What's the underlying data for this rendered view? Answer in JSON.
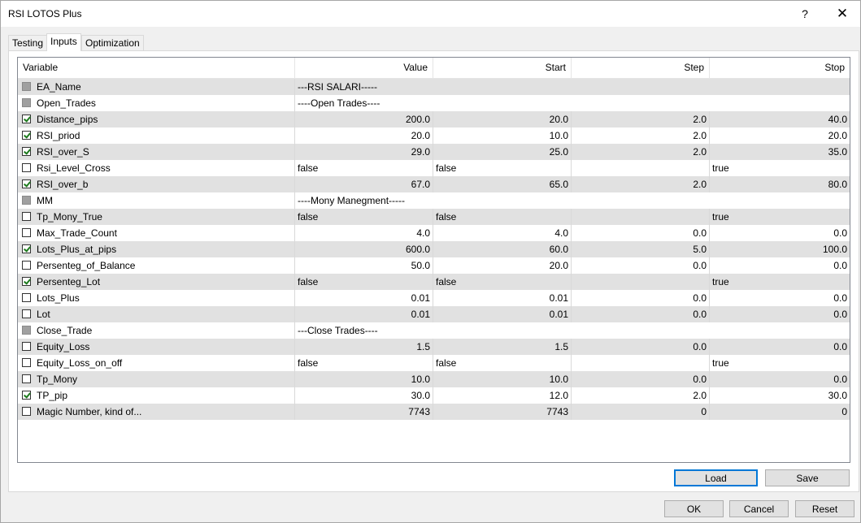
{
  "window": {
    "title": "RSI LOTOS Plus",
    "help_label": "?",
    "close_label": "✕"
  },
  "tabs": [
    {
      "label": "Testing",
      "active": false
    },
    {
      "label": "Inputs",
      "active": true
    },
    {
      "label": "Optimization",
      "active": false
    }
  ],
  "grid": {
    "columns": [
      "Variable",
      "Value",
      "Start",
      "Step",
      "Stop"
    ],
    "rows": [
      {
        "name": "EA_Name",
        "checked": false,
        "disabled": true,
        "span": "---RSI SALARI-----"
      },
      {
        "name": "Open_Trades",
        "checked": false,
        "disabled": true,
        "span": "----Open Trades----"
      },
      {
        "name": "Distance_pips",
        "checked": true,
        "disabled": false,
        "value": "200.0",
        "start": "20.0",
        "step": "2.0",
        "stop": "40.0"
      },
      {
        "name": "RSI_priod",
        "checked": true,
        "disabled": false,
        "value": "20.0",
        "start": "10.0",
        "step": "2.0",
        "stop": "20.0"
      },
      {
        "name": "RSI_over_S",
        "checked": true,
        "disabled": false,
        "value": "29.0",
        "start": "25.0",
        "step": "2.0",
        "stop": "35.0"
      },
      {
        "name": "Rsi_Level_Cross",
        "checked": false,
        "disabled": false,
        "bool": true,
        "value": "false",
        "start": "false",
        "step": "",
        "stop": "true"
      },
      {
        "name": "RSI_over_b",
        "checked": true,
        "disabled": false,
        "value": "67.0",
        "start": "65.0",
        "step": "2.0",
        "stop": "80.0"
      },
      {
        "name": "MM",
        "checked": false,
        "disabled": true,
        "span": "----Mony Manegment-----"
      },
      {
        "name": "Tp_Mony_True",
        "checked": false,
        "disabled": false,
        "bool": true,
        "value": "false",
        "start": "false",
        "step": "",
        "stop": "true"
      },
      {
        "name": "Max_Trade_Count",
        "checked": false,
        "disabled": false,
        "value": "4.0",
        "start": "4.0",
        "step": "0.0",
        "stop": "0.0"
      },
      {
        "name": "Lots_Plus_at_pips",
        "checked": true,
        "disabled": false,
        "value": "600.0",
        "start": "60.0",
        "step": "5.0",
        "stop": "100.0"
      },
      {
        "name": "Persenteg_of_Balance",
        "checked": false,
        "disabled": false,
        "value": "50.0",
        "start": "20.0",
        "step": "0.0",
        "stop": "0.0"
      },
      {
        "name": "Persenteg_Lot",
        "checked": true,
        "disabled": false,
        "bool": true,
        "value": "false",
        "start": "false",
        "step": "",
        "stop": "true"
      },
      {
        "name": "Lots_Plus",
        "checked": false,
        "disabled": false,
        "value": "0.01",
        "start": "0.01",
        "step": "0.0",
        "stop": "0.0"
      },
      {
        "name": "Lot",
        "checked": false,
        "disabled": false,
        "value": "0.01",
        "start": "0.01",
        "step": "0.0",
        "stop": "0.0"
      },
      {
        "name": "Close_Trade",
        "checked": false,
        "disabled": true,
        "span": "---Close Trades----"
      },
      {
        "name": "Equity_Loss",
        "checked": false,
        "disabled": false,
        "value": "1.5",
        "start": "1.5",
        "step": "0.0",
        "stop": "0.0"
      },
      {
        "name": "Equity_Loss_on_off",
        "checked": false,
        "disabled": false,
        "bool": true,
        "value": "false",
        "start": "false",
        "step": "",
        "stop": "true"
      },
      {
        "name": "Tp_Mony",
        "checked": false,
        "disabled": false,
        "value": "10.0",
        "start": "10.0",
        "step": "0.0",
        "stop": "0.0"
      },
      {
        "name": "TP_pip",
        "checked": true,
        "disabled": false,
        "value": "30.0",
        "start": "12.0",
        "step": "2.0",
        "stop": "30.0"
      },
      {
        "name": "Magic Number, kind of...",
        "checked": false,
        "disabled": false,
        "value": "7743",
        "start": "7743",
        "step": "0",
        "stop": "0"
      }
    ]
  },
  "buttons": {
    "load": "Load",
    "save": "Save",
    "ok": "OK",
    "cancel": "Cancel",
    "reset": "Reset"
  }
}
